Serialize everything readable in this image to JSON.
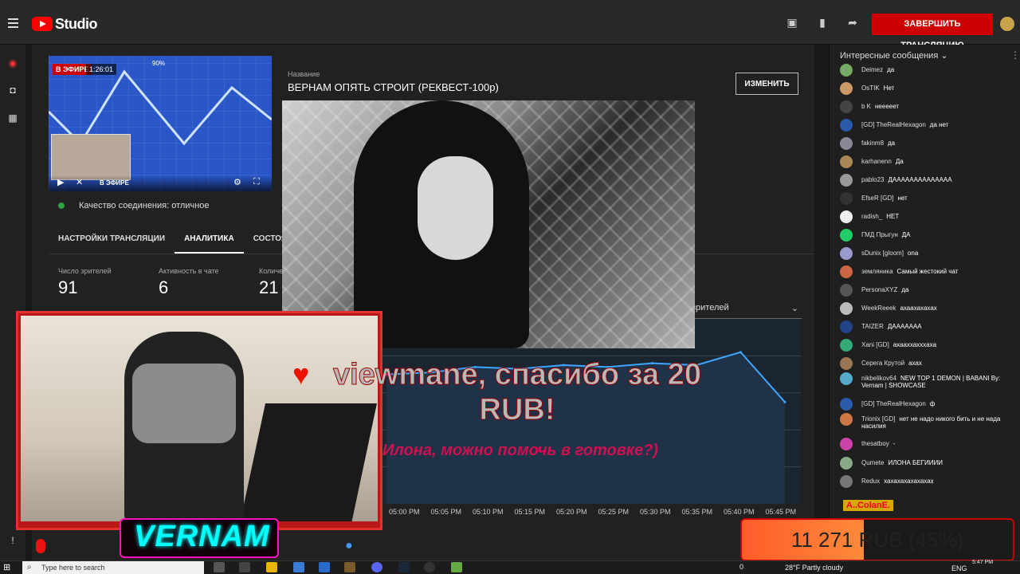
{
  "header": {
    "logo_text": "Studio",
    "end_stream_label": "ЗАВЕРШИТЬ ТРАНСЛЯЦИЮ"
  },
  "preview": {
    "live_badge": "В ЭФИРЕ",
    "elapsed": "1:26:01",
    "progress_label": "90%",
    "live_ctrl_label": "В ЭФИРЕ"
  },
  "stream": {
    "connection_quality": "Качество соединения: отличное",
    "title_label": "Название",
    "title_value": "ВЕРНАМ ОПЯТЬ СТРОИТ (РЕКВЕСТ-100р)",
    "edit_label": "ИЗМЕНИТЬ"
  },
  "tabs": [
    {
      "label": "НАСТРОЙКИ ТРАНСЛЯЦИИ"
    },
    {
      "label": "АНАЛИТИКА"
    },
    {
      "label": "СОСТОЯ"
    }
  ],
  "stats": [
    {
      "label": "Число зрителей",
      "value": "91"
    },
    {
      "label": "Активность в чате",
      "value": "6"
    },
    {
      "label": "Количе",
      "value": "21"
    }
  ],
  "chart_select_label": "зрителей",
  "chart_data": {
    "type": "line",
    "x": [
      "05:00 PM",
      "05:05 PM",
      "05:10 PM",
      "05:15 PM",
      "05:20 PM",
      "05:25 PM",
      "05:30 PM",
      "05:35 PM",
      "05:40 PM",
      "05:45 PM"
    ],
    "ylim": [
      0,
      100
    ],
    "grid": true,
    "series": [
      {
        "values": [
          70,
          71,
          74,
          73,
          75,
          74,
          76,
          75,
          82,
          55
        ]
      }
    ]
  },
  "overlay": {
    "donation_text": "viewmane, спасибо за 20 RUB!",
    "donation_message": "Илона, можно помочь в готовке?)",
    "streamer_name": "VERNAM",
    "goal_amount": "11 271 RUB (45%)",
    "goal_progress": 0.45
  },
  "chat": {
    "header": "Интересные сообщения",
    "messages": [
      {
        "author": "Deimez",
        "text": "да",
        "color": "#7a6"
      },
      {
        "author": "OsTIK",
        "text": "Нет",
        "color": "#c96"
      },
      {
        "author": "b K",
        "text": "нееееет",
        "color": "#444"
      },
      {
        "author": "[GD] TheRealHexagon",
        "text": "да нет",
        "color": "#2a5aa8"
      },
      {
        "author": "fakinm8",
        "text": "да",
        "color": "#889"
      },
      {
        "author": "karhanenn",
        "text": "Да",
        "color": "#a85"
      },
      {
        "author": "pablo23",
        "text": "ДАААААААААААААА",
        "color": "#999"
      },
      {
        "author": "EfseR [GD]",
        "text": "нет",
        "color": "#333"
      },
      {
        "author": "radish_",
        "text": "НЕТ",
        "color": "#eee"
      },
      {
        "author": "ГМД Прыгун",
        "text": "ДА",
        "color": "#2c6"
      },
      {
        "author": "sDunix [gloom]",
        "text": "ona",
        "color": "#99c"
      },
      {
        "author": "земляника",
        "text": "Самый жестокий чат",
        "color": "#c64"
      },
      {
        "author": "PersonaXYZ",
        "text": "да",
        "color": "#555"
      },
      {
        "author": "WeekReeek",
        "text": "ахаахахахах",
        "color": "#bbb"
      },
      {
        "author": "TAIZER",
        "text": "ДААААААА",
        "color": "#248"
      },
      {
        "author": "Xani [GD]",
        "text": "ахааххахххаха",
        "color": "#3a7"
      },
      {
        "author": "Серега Крутой",
        "text": "ахах",
        "color": "#975"
      },
      {
        "author": "nikbelikov64",
        "text": "NEW TOP 1 DEMON | BABANI By: Vernam | SHOWCASE",
        "color": "#5ac"
      },
      {
        "author": "[GD] TheRealHexagon",
        "text": "ф",
        "color": "#2a5aa8"
      },
      {
        "author": "Trionix [GD]",
        "text": "нет не надо никого бить и не нада насилия",
        "color": "#c74"
      },
      {
        "author": "thesatboy",
        "text": "-",
        "color": "#c4a"
      },
      {
        "author": "Qumete",
        "text": "ИЛОНА БЕГИИИИ",
        "color": "#8a8"
      },
      {
        "author": "Redux",
        "text": "хахахахахахахах",
        "color": "#777"
      }
    ],
    "pinned_preview": "A..ColanE."
  },
  "taskbar": {
    "search_placeholder": "Type here to search",
    "weather": "28°F  Partly cloudy",
    "lang": "ENG",
    "clock": "5:47 PM",
    "counter": "0"
  }
}
